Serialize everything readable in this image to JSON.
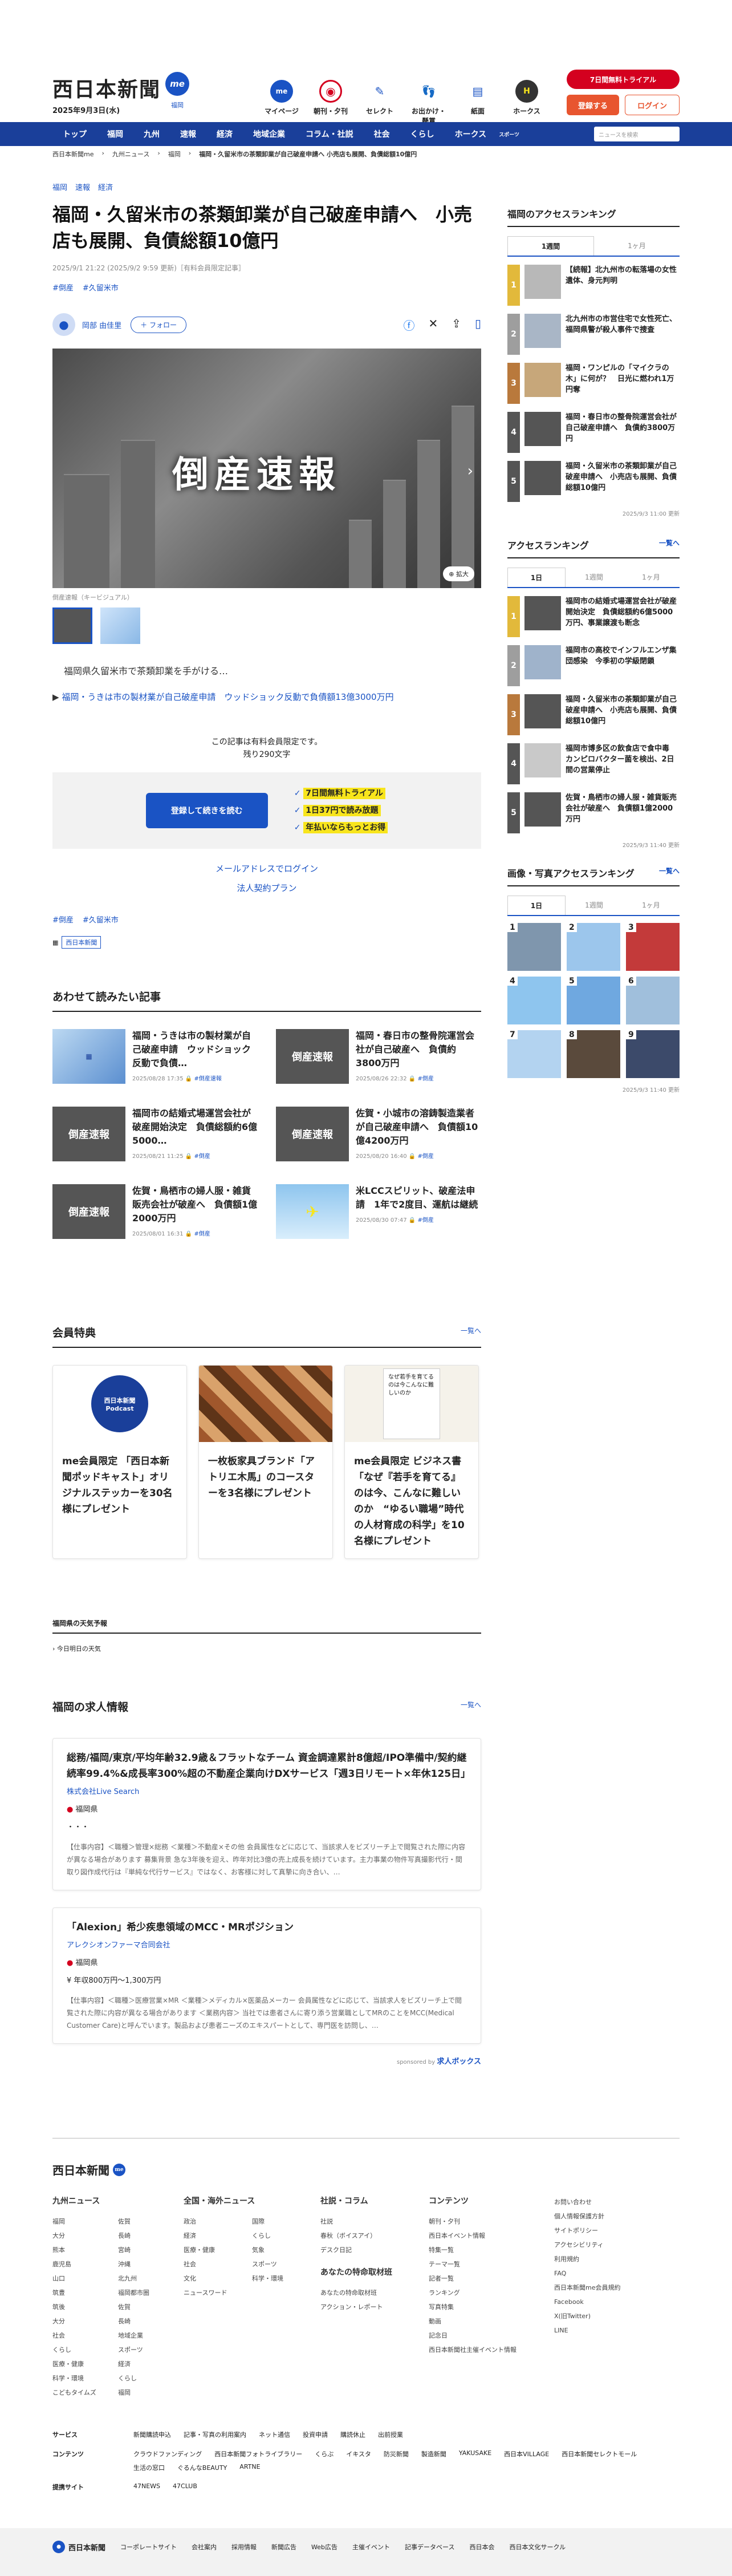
{
  "header": {
    "logo": "西日本新聞",
    "me_label": "me",
    "region": "福岡",
    "date": "2025年9月3日(水)",
    "icons": [
      {
        "label": "マイページ",
        "icon": "me-icon"
      },
      {
        "label": "朝刊・夕刊",
        "icon": "target-icon"
      },
      {
        "label": "セレクト",
        "icon": "select-icon"
      },
      {
        "label": "お出かけ・懸賞",
        "icon": "footprint-icon"
      },
      {
        "label": "紙面",
        "icon": "newspaper-icon"
      },
      {
        "label": "ホークス",
        "icon": "hawks-icon"
      }
    ],
    "trial": "7日間無料トライアル",
    "register": "登録する",
    "login": "ログイン"
  },
  "nav": {
    "items": [
      "トップ",
      "福岡",
      "九州",
      "速報",
      "経済",
      "地域企業",
      "コラム・社説",
      "社会",
      "くらし",
      "ホークス",
      "スポーツ"
    ],
    "search_placeholder": "ニュースを検索"
  },
  "breadcrumb": [
    "西日本新聞me",
    "九州ニュース",
    "福岡",
    "福岡・久留米市の茶類卸業が自己破産申請へ 小売店も展開、負債総額10億円"
  ],
  "article": {
    "cats": [
      "福岡",
      "速報",
      "経済"
    ],
    "title": "福岡・久留米市の茶類卸業が自己破産申請へ　小売店も展開、負債総額10億円",
    "meta": "2025/9/1 21:22 (2025/9/2 9:59 更新)［有料会員限定記事］",
    "tags": [
      "#倒産",
      "#久留米市"
    ],
    "author": "岡部 由佳里",
    "follow": "＋ フォロー",
    "hero_text": "倒産速報",
    "expand": "拡大",
    "caption": "倒産速報（キービジュアル）",
    "lead": "福岡県久留米市で茶類卸業を手がける…",
    "related": "福岡・うきは市の製材業が自己破産申請　ウッドショック反動で負債額13億3000万円",
    "pay_line1": "この記事は有料会員限定です。",
    "pay_line2": "残り290文字",
    "pay_button": "登録して続きを読む",
    "pay_points": [
      "7日間無料トライアル",
      "1日37円で読み放題",
      "年払いならもっとお得"
    ],
    "login_link": "メールアドレスでログイン",
    "corp_link": "法人契約プラン",
    "tags2": [
      "#倒産",
      "#久留米市"
    ],
    "source_badge": "西日本新聞"
  },
  "recommend": {
    "title": "あわせて読みたい記事",
    "items": [
      {
        "title": "福岡・うきは市の製材業が自己破産申請　ウッドショック反動で負債…",
        "date": "2025/08/28 17:35",
        "tag": "#倒産速報"
      },
      {
        "title": "福岡・春日市の整骨院運営会社が自己破産へ　負債約3800万円",
        "date": "2025/08/26 22:32",
        "tag": "#倒産"
      },
      {
        "title": "福岡市の結婚式場運営会社が破産開始決定　負債総額約6億5000…",
        "date": "2025/08/21 11:25",
        "tag": "#倒産"
      },
      {
        "title": "佐賀・小城市の溶鋳製造業者が自己破産申請へ　負債額10億4200万円",
        "date": "2025/08/20 16:40",
        "tag": "#倒産"
      },
      {
        "title": "佐賀・鳥栖市の婦人服・雑貨販売会社が破産へ　負債額1億2000万円",
        "date": "2025/08/01 16:31",
        "tag": "#倒産"
      },
      {
        "title": "米LCCスピリット、破産法申請　1年で2度目、運航は継続",
        "date": "2025/08/30 07:47",
        "tag": "#倒産"
      }
    ],
    "thumb_text": "倒産速報"
  },
  "perks": {
    "title": "会員特典",
    "more": "一覧へ",
    "items": [
      {
        "title": "me会員限定 「西日本新聞ポッドキャスト」オリジナルステッカーを30名様にプレゼント",
        "img_text": "西日本新聞 Podcast"
      },
      {
        "title": "一枚板家具ブランド「アトリエ木馬」のコースターを3名様にプレゼント",
        "img_text": ""
      },
      {
        "title": "me会員限定 ビジネス書「なぜ『若手を育てる』のは今、こんなに難しいのか　“ゆるい職場”時代の人材育成の科学」を10名様にプレゼント",
        "img_text": "なぜ若手を育てるのは今こんなに難しいのか"
      }
    ]
  },
  "weather": {
    "title": "福岡県の天気予報",
    "sub": "今日明日の天気"
  },
  "jobs": {
    "title": "福岡の求人情報",
    "more": "一覧へ",
    "items": [
      {
        "title": "総務/福岡/東京/平均年齢32.9歳＆フラットなチーム 資金調達累計8億超/IPO準備中/契約継続率99.4%&成長率300%超の不動産企業向けDXサービス「週3日リモート×年休125日」",
        "company": "株式会社Live Search",
        "loc": "福岡県",
        "tag": "・・・",
        "desc": "【仕事内容】＜職種＞管理×総務 ＜業種＞不動産×その他 会員属性などに応じて、当該求人をビズリーチ上で閲覧された際に内容が異なる場合があります 募集背景 急な3年後を迎え、昨年対比3億の売上成長を続けています。主力事業の物件写真撮影代行・間取り図作成代行は『単純な代行サービス』ではなく、お客様に対して真摯に向き合い、…"
      },
      {
        "title": "「Alexion」希少疾患領域のMCC・MRポジション",
        "company": "アレクシオンファーマ合同会社",
        "loc": "福岡県",
        "salary": "年収800万円～1,300万円",
        "desc": "【仕事内容】＜職種＞医療営業×MR ＜業種＞メディカル×医薬品メーカー 会員属性などに応じて、当該求人をビズリーチ上で閲覧された際に内容が異なる場合があります ＜業務内容＞ 当社では患者さんに寄り添う営業職としてMRのことをMCC(Medical Customer Care)と呼んでいます。製品および患者ニーズのエキスパートとして、専門医を訪問し、…"
      }
    ],
    "sponsor": "sponsored by",
    "sponsor_name": "求人ボックス"
  },
  "sidebar": {
    "access_title": "福岡のアクセスランキング",
    "access_tabs": [
      "1週間",
      "1ヶ月"
    ],
    "access_items": [
      "【続報】北九州市の転落場の女性遺体、身元判明",
      "北九州市の市営住宅で女性死亡、福岡県警が殺人事件で捜査",
      "福岡・ワンピルの「マイクラの木」に何が？　日光に燃われ1万円奪",
      "福岡・春日市の整骨院運営会社が自己破産申請へ　負債約3800万円",
      "福岡・久留米市の茶類卸業が自己破産申請へ　小売店も展開、負債総額10億円"
    ],
    "access_update": "2025/9/3 11:00 更新",
    "rank_title": "アクセスランキング",
    "rank_more": "一覧へ",
    "rank_tabs": [
      "1日",
      "1週間",
      "1ヶ月"
    ],
    "rank_items": [
      "福岡市の結婚式場運営会社が破産開始決定　負債総額約6億5000万円、事業譲渡も断念",
      "福岡市の高校でインフルエンザ集団感染　今季初の学級閉鎖",
      "福岡・久留米市の茶類卸業が自己破産申請へ　小売店も展開、負債総額10億円",
      "福岡市博多区の飲食店で食中毒　カンピロバクター菌を検出、2日間の営業停止",
      "佐賀・鳥栖市の婦人服・雑貨販売会社が破産へ　負債額1億2000万円"
    ],
    "rank_update": "2025/9/3 11:40 更新",
    "img_title": "画像・写真アクセスランキング",
    "img_more": "一覧へ",
    "img_tabs": [
      "1日",
      "1週間",
      "1ヶ月"
    ],
    "img_update": "2025/9/3 11:40 更新",
    "img_ranks": [
      "1",
      "2",
      "3",
      "4",
      "5",
      "6",
      "7",
      "8",
      "9"
    ]
  },
  "footer": {
    "logo": "西日本新聞",
    "cols": [
      {
        "title": "九州ニュース",
        "items": [
          "福岡",
          "佐賀",
          "大分",
          "長崎",
          "熊本",
          "宮崎",
          "鹿児島",
          "沖縄",
          "山口",
          "北九州",
          "筑豊",
          "福岡都市圏",
          "筑後",
          "佐賀",
          "大分",
          "長崎",
          "社会",
          "地域企業",
          "くらし",
          "スポーツ",
          "医療・健康",
          "経済",
          "科学・環境",
          "くらし",
          "こどもタイムズ",
          "福岡"
        ]
      },
      {
        "title": "全国・海外ニュース",
        "items": [
          "政治",
          "国際",
          "経済",
          "くらし",
          "医療・健康",
          "気象",
          "社会",
          "スポーツ",
          "文化",
          "科学・環境",
          "ニュースワード"
        ]
      },
      {
        "title": "社説・コラム",
        "items": [
          "社説",
          "春秋（ボイスアイ）",
          "デスク日記"
        ]
      },
      {
        "title": "あなたの特命取材班",
        "items": [
          "あなたの特命取材班",
          "アクション・レポート"
        ]
      },
      {
        "title": "コンテンツ",
        "items": [
          "朝刊・夕刊",
          "西日本イベント情報",
          "特集一覧",
          "テーマ一覧",
          "記者一覧",
          "ランキング",
          "写真特集",
          "動画",
          "記念日",
          "西日本新聞社主催イベント情報"
        ]
      },
      {
        "title": "",
        "items": [
          "お問い合わせ",
          "個人情報保護方針",
          "サイトポリシー",
          "アクセシビリティ",
          "利用規約",
          "FAQ",
          "西日本新聞me会員規約",
          "Facebook",
          "X(旧Twitter)",
          "LINE"
        ]
      }
    ],
    "rows": [
      {
        "label": "サービス",
        "items": [
          "新聞購読申込",
          "記事・写真の利用案内",
          "ネット通信",
          "投資申請",
          "購読休止",
          "出前授業"
        ]
      },
      {
        "label": "コンテンツ",
        "items": [
          "クラウドファンディング",
          "西日本新聞フォトライブラリー",
          "くらぶ",
          "イキスタ",
          "防災新聞",
          "製造新聞",
          "YAKUSAKE",
          "西日本VILLAGE",
          "西日本新聞セレクトモール",
          "生活の窓口",
          "ぐるんなBEAUTY",
          "ARTNE"
        ]
      },
      {
        "label": "提携サイト",
        "items": [
          "47NEWS",
          "47CLUB"
        ]
      }
    ],
    "bar_logo": "西日本新聞",
    "bar_items": [
      "コーポレートサイト",
      "会社案内",
      "採用情報",
      "新聞広告",
      "Web広告",
      "主催イベント",
      "記事データベース",
      "西日本会",
      "西日本文化サークル"
    ]
  }
}
